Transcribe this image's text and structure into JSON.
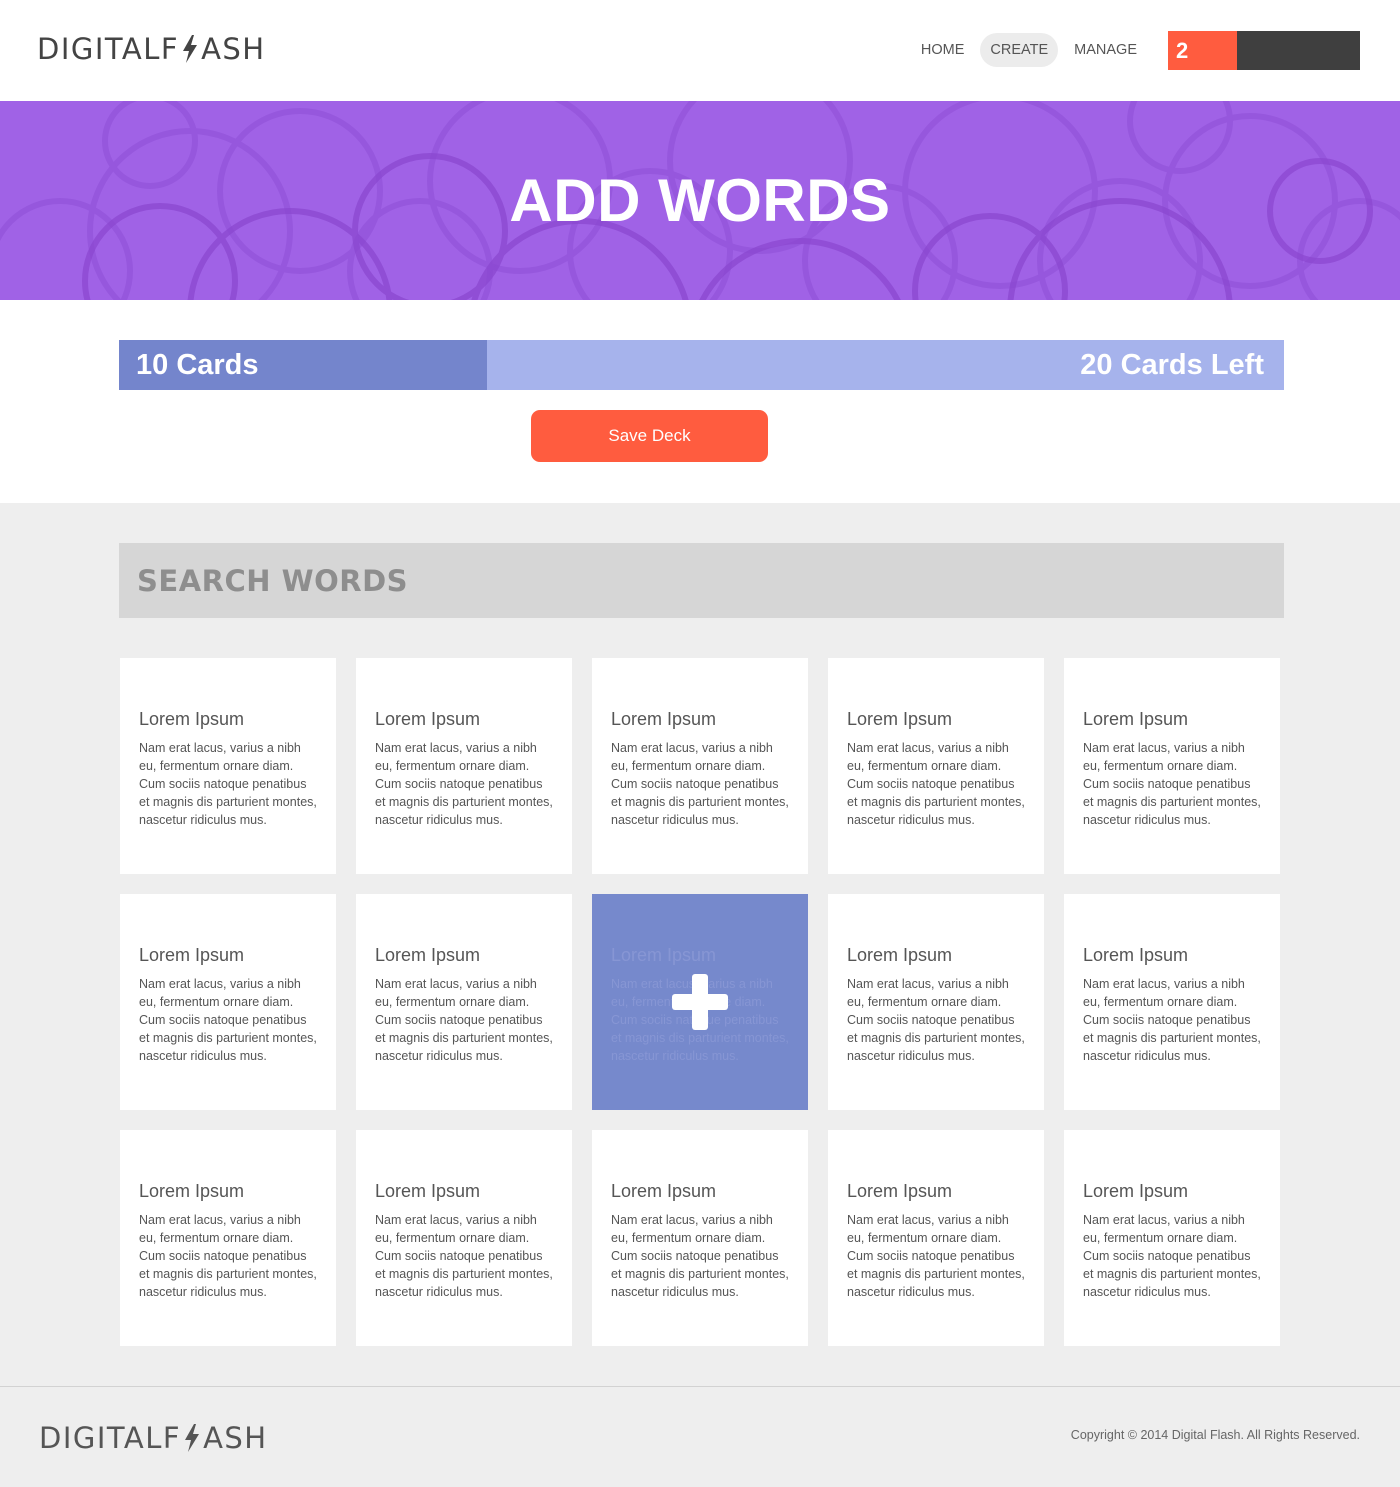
{
  "header": {
    "logo": {
      "left": "DIGITAL",
      "mid": "F",
      "right": "ASH"
    },
    "nav": [
      {
        "label": "HOME",
        "active": false
      },
      {
        "label": "CREATE",
        "active": true
      },
      {
        "label": "MANAGE",
        "active": false
      }
    ],
    "counter": "2"
  },
  "hero": {
    "title": "ADD WORDS"
  },
  "progress": {
    "cards_label": "10 Cards",
    "left_label": "20 Cards Left",
    "fraction": 0.316
  },
  "save_button": "Save Deck",
  "search": {
    "placeholder": "SEARCH WORDS"
  },
  "cards": [
    {
      "title": "Lorem Ipsum",
      "body": "Nam erat lacus, varius a nibh eu, fermentum ornare diam. Cum sociis natoque penatibus et magnis dis parturient montes, nascetur ridiculus mus.",
      "selected": false
    },
    {
      "title": "Lorem Ipsum",
      "body": "Nam erat lacus, varius a nibh eu, fermentum ornare diam. Cum sociis natoque penatibus et magnis dis parturient montes, nascetur ridiculus mus.",
      "selected": false
    },
    {
      "title": "Lorem Ipsum",
      "body": "Nam erat lacus, varius a nibh eu, fermentum ornare diam. Cum sociis natoque penatibus et magnis dis parturient montes, nascetur ridiculus mus.",
      "selected": false
    },
    {
      "title": "Lorem Ipsum",
      "body": "Nam erat lacus, varius a nibh eu, fermentum ornare diam. Cum sociis natoque penatibus et magnis dis parturient montes, nascetur ridiculus mus.",
      "selected": false
    },
    {
      "title": "Lorem Ipsum",
      "body": "Nam erat lacus, varius a nibh eu, fermentum ornare diam. Cum sociis natoque penatibus et magnis dis parturient montes, nascetur ridiculus mus.",
      "selected": false
    },
    {
      "title": "Lorem Ipsum",
      "body": "Nam erat lacus, varius a nibh eu, fermentum ornare diam. Cum sociis natoque penatibus et magnis dis parturient montes, nascetur ridiculus mus.",
      "selected": false
    },
    {
      "title": "Lorem Ipsum",
      "body": "Nam erat lacus, varius a nibh eu, fermentum ornare diam. Cum sociis natoque penatibus et magnis dis parturient montes, nascetur ridiculus mus.",
      "selected": false
    },
    {
      "title": "Lorem Ipsum",
      "body": "Nam erat lacus, varius a nibh eu, fermentum ornare diam. Cum sociis natoque penatibus et magnis dis parturient montes, nascetur ridiculus mus.",
      "selected": true
    },
    {
      "title": "Lorem Ipsum",
      "body": "Nam erat lacus, varius a nibh eu, fermentum ornare diam. Cum sociis natoque penatibus et magnis dis parturient montes, nascetur ridiculus mus.",
      "selected": false
    },
    {
      "title": "Lorem Ipsum",
      "body": "Nam erat lacus, varius a nibh eu, fermentum ornare diam. Cum sociis natoque penatibus et magnis dis parturient montes, nascetur ridiculus mus.",
      "selected": false
    },
    {
      "title": "Lorem Ipsum",
      "body": "Nam erat lacus, varius a nibh eu, fermentum ornare diam. Cum sociis natoque penatibus et magnis dis parturient montes, nascetur ridiculus mus.",
      "selected": false
    },
    {
      "title": "Lorem Ipsum",
      "body": "Nam erat lacus, varius a nibh eu, fermentum ornare diam. Cum sociis natoque penatibus et magnis dis parturient montes, nascetur ridiculus mus.",
      "selected": false
    },
    {
      "title": "Lorem Ipsum",
      "body": "Nam erat lacus, varius a nibh eu, fermentum ornare diam. Cum sociis natoque penatibus et magnis dis parturient montes, nascetur ridiculus mus.",
      "selected": false
    },
    {
      "title": "Lorem Ipsum",
      "body": "Nam erat lacus, varius a nibh eu, fermentum ornare diam. Cum sociis natoque penatibus et magnis dis parturient montes, nascetur ridiculus mus.",
      "selected": false
    },
    {
      "title": "Lorem Ipsum",
      "body": "Nam erat lacus, varius a nibh eu, fermentum ornare diam. Cum sociis natoque penatibus et magnis dis parturient montes, nascetur ridiculus mus.",
      "selected": false
    }
  ],
  "footer": {
    "logo": {
      "left": "DIGITAL",
      "mid": "F",
      "right": "ASH"
    },
    "copyright": "Copyright ©  2014 Digital Flash.  All Rights Reserved."
  },
  "colors": {
    "accent": "#ff5c3f",
    "hero_bg": "#a062e6",
    "progress_fill": "#7485cc",
    "progress_track": "#a6b3ec",
    "selected_card": "#7689cc"
  },
  "icons": {
    "logo_bolt": "lightning-bolt-icon",
    "add": "plus-icon"
  }
}
